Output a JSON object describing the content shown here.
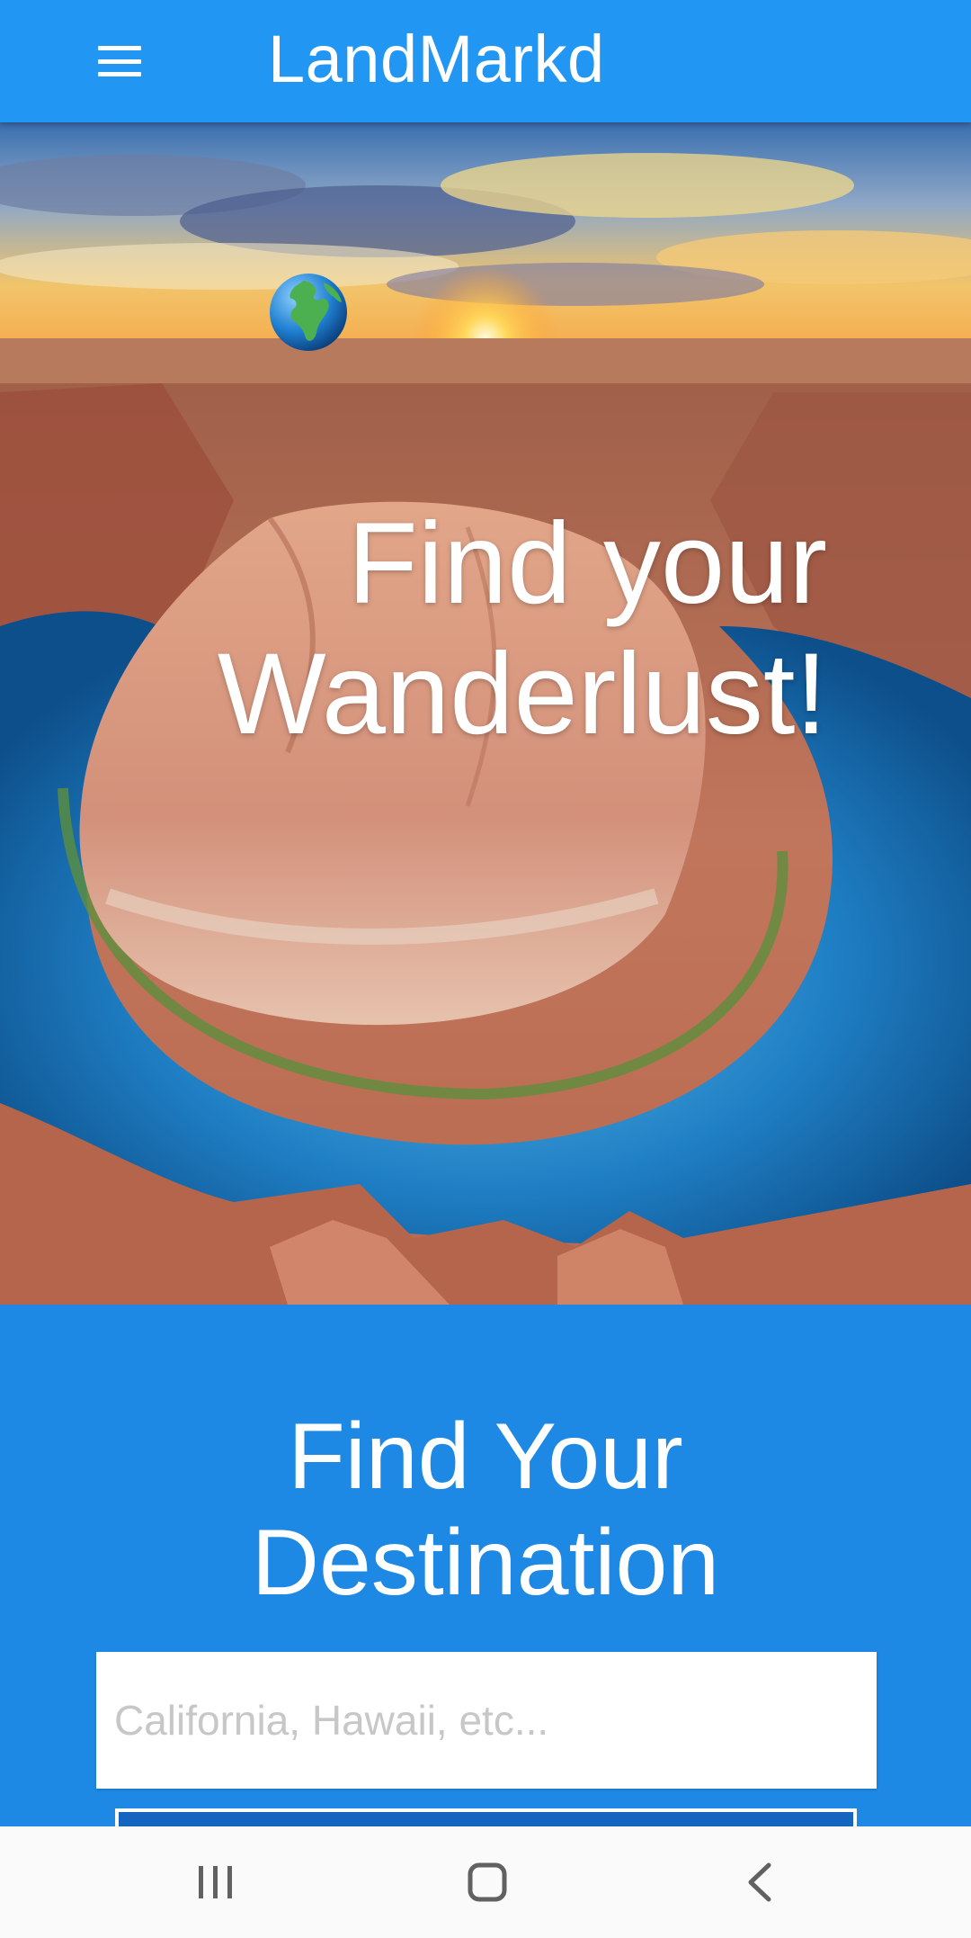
{
  "appbar": {
    "title": "LandMarkd",
    "menu_icon": "hamburger-menu-icon"
  },
  "hero": {
    "globe_icon": "globe-europe-africa-icon",
    "title": "Find your\nWanderlust!",
    "image": "horseshoe-bend canyon river at sunset"
  },
  "destination": {
    "title": "Find Your\nDestination",
    "search_placeholder": "California, Hawaii, etc...",
    "search_value": ""
  },
  "navbar": {
    "recents_icon": "recent-apps-icon",
    "home_icon": "home-icon",
    "back_icon": "back-icon"
  },
  "colors": {
    "appbar": "#2196f3",
    "section_bg": "#1e88e5",
    "text": "#ffffff",
    "navbar": "#fafafa"
  }
}
